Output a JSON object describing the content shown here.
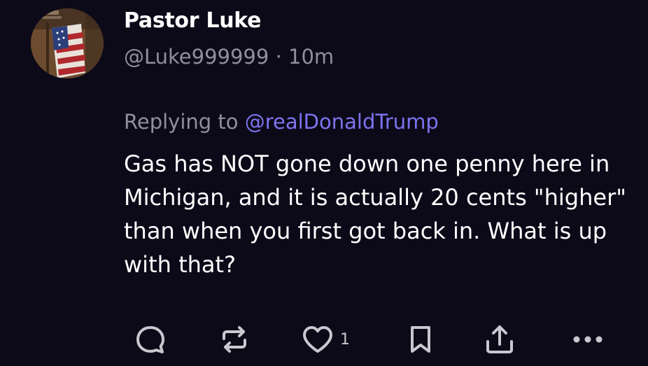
{
  "post": {
    "author_name": "Pastor Luke",
    "handle": "@Luke999999",
    "separator": "·",
    "time_ago": "10m",
    "reply_prefix": "Replying to",
    "reply_mention": "@realDonaldTrump",
    "text": "Gas has NOT gone down one penny here in Michigan, and it is actually 20 cents \"higher\" than when you first got back in. What is up with that?"
  },
  "actions": {
    "reply_icon": "speech-bubble-icon",
    "repost_icon": "repost-arrows-icon",
    "like_icon": "heart-icon",
    "like_count": "1",
    "bookmark_icon": "bookmark-icon",
    "share_icon": "share-upload-icon",
    "more_icon": "ellipsis-icon"
  },
  "colors": {
    "background": "#0c0a18",
    "text_primary": "#ffffff",
    "text_secondary": "#8f8f9c",
    "mention": "#7e73f0",
    "icon": "#c8c8d0"
  }
}
